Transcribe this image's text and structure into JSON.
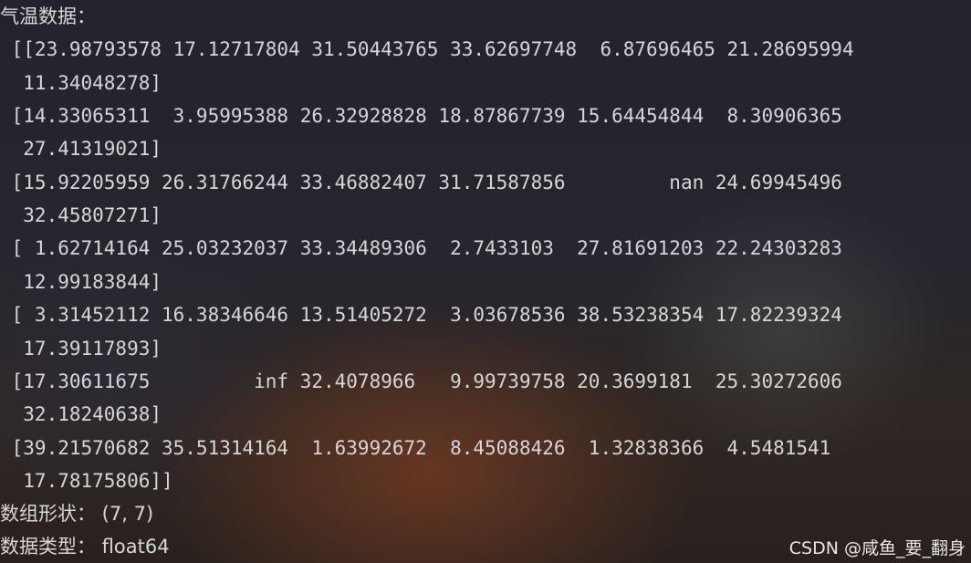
{
  "terminal": {
    "lines": [
      "气温数据：",
      " [[23.98793578 17.12717804 31.50443765 33.62697748  6.87696465 21.28695994",
      "  11.34048278]",
      " [14.33065311  3.95995388 26.32928828 18.87867739 15.64454844  8.30906365",
      "  27.41319021]",
      " [15.92205959 26.31766244 33.46882407 31.71587856         nan 24.69945496",
      "  32.45807271]",
      " [ 1.62714164 25.03232037 33.34489306  2.7433103  27.81691203 22.24303283",
      "  12.99183844]",
      " [ 3.31452112 16.38346646 13.51405272  3.03678536 38.53238354 17.82239324",
      "  17.39117893]",
      " [17.30611675         inf 32.4078966   9.99739758 20.3699181  25.30272606",
      "  32.18240638]",
      " [39.21570682 35.51314164  1.63992672  8.45088426  1.32838366  4.5481541",
      "  17.78175806]]",
      "数组形状： (7, 7)",
      "数据类型： float64"
    ]
  },
  "watermark": "CSDN @咸鱼_要_翻身"
}
